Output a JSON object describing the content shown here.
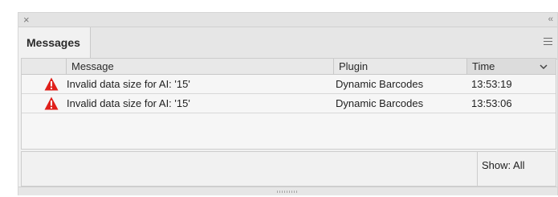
{
  "window": {
    "close_icon": "close-icon",
    "collapse_icon": "double-chevron-left-icon"
  },
  "tab": {
    "label": "Messages"
  },
  "panel_menu_icon": "hamburger-menu-icon",
  "table": {
    "columns": {
      "message": "Message",
      "plugin": "Plugin",
      "time": "Time"
    },
    "sort_icon": "chevron-down-icon",
    "rows": [
      {
        "icon": "warning-icon",
        "message": "Invalid data size for AI: '15'",
        "plugin": "Dynamic Barcodes",
        "time": "13:53:19"
      },
      {
        "icon": "warning-icon",
        "message": "Invalid data size for AI: '15'",
        "plugin": "Dynamic Barcodes",
        "time": "13:53:06"
      }
    ]
  },
  "footer": {
    "show_label": "Show: All"
  },
  "colors": {
    "warning": "#e0201b",
    "panel_bg": "#f1f1f1",
    "header_bg": "#e8e8e8"
  }
}
